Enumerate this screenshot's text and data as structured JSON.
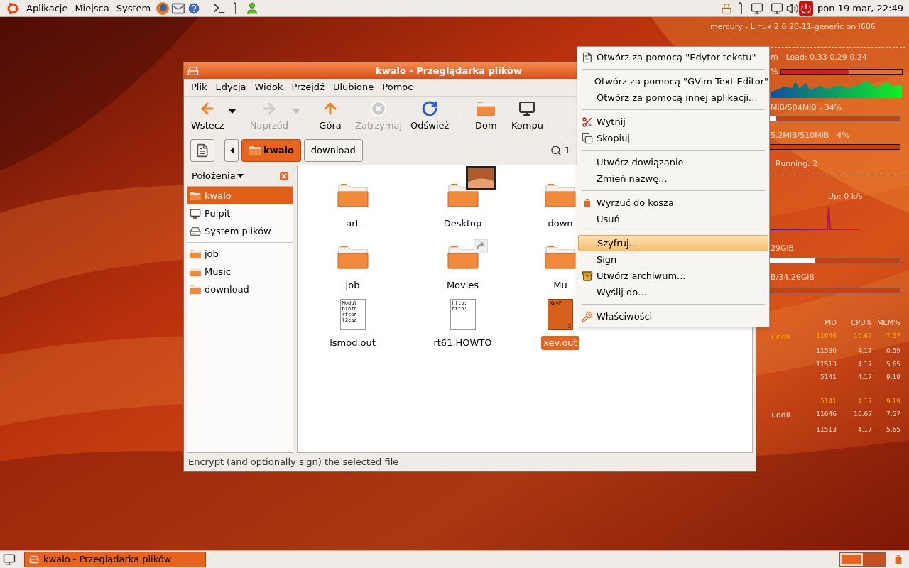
{
  "top_panel": {
    "menus": [
      "Aplikacje",
      "Miejsca",
      "System"
    ],
    "clock": "pon 19 mar, 22:49"
  },
  "conky": {
    "host": "mercury - Linux 2.6.20-11-generic on i686",
    "load": "m - Load: 0.33 0.29 0.24",
    "cpu_mark": "%",
    "cpu": {
      "level": 0.56
    },
    "ram": "MiB/504MiB - 34%",
    "ram_bar": {
      "level": 0.05
    },
    "swap": "5.2MiB/510MiB - 4%",
    "swap_bar": {
      "level": 0
    },
    "running": "Running: 2",
    "up": "Up: 0 k/s",
    "disk1": "29GiB",
    "disk1_bar": {
      "level": 0.35
    },
    "disk2": "B/34.26GiB",
    "disk2_bar": {
      "level": 0
    },
    "columns": [
      "PID",
      "CPU%",
      "MEM%"
    ],
    "top_cpu": [
      {
        "name": "uodli",
        "pid": "11646",
        "cpu": "16.67",
        "mem": "7.57",
        "highlight": true
      },
      {
        "pid": "11530",
        "cpu": "4.17",
        "mem": "0.59",
        "highlight": false
      },
      {
        "pid": "11513",
        "cpu": "4.17",
        "mem": "5.65",
        "highlight": false
      },
      {
        "pid": "5141",
        "cpu": "4.17",
        "mem": "9.19",
        "highlight": false
      }
    ],
    "top_mem": [
      {
        "pid": "5141",
        "cpu": "4.17",
        "mem": "9.19",
        "highlight": true
      },
      {
        "name": "uodli",
        "pid": "11646",
        "cpu": "16.67",
        "mem": "7.57",
        "highlight": false
      },
      {
        "pid": "11513",
        "cpu": "4.17",
        "mem": "5.65",
        "highlight": false
      }
    ]
  },
  "window": {
    "title": "kwalo - Przeglądarka plików",
    "menu": [
      "Plik",
      "Edycja",
      "Widok",
      "Przejdź",
      "Ulubione",
      "Pomoc"
    ],
    "toolbar": [
      {
        "kind": "back",
        "label": "Wstecz",
        "disabled": false,
        "dropdown": true
      },
      {
        "kind": "forward",
        "label": "Naprzód",
        "disabled": true,
        "dropdown": true
      },
      {
        "kind": "up",
        "label": "Góra",
        "disabled": false,
        "dropdown": false
      },
      {
        "kind": "stop",
        "label": "Zatrzymaj",
        "disabled": true,
        "dropdown": false
      },
      {
        "kind": "reload",
        "label": "Odśwież",
        "disabled": false,
        "dropdown": false
      },
      {
        "kind": "separator"
      },
      {
        "kind": "home",
        "label": "Dom",
        "disabled": false,
        "dropdown": false
      },
      {
        "kind": "computer",
        "label": "Kompu",
        "disabled": false,
        "dropdown": false
      }
    ],
    "path": [
      {
        "label": "kwalo",
        "selected": true
      },
      {
        "label": "download",
        "selected": false
      }
    ],
    "zoom": "1",
    "sidebar": {
      "title": "Położenia",
      "groups": [
        {
          "items": [
            {
              "kind": "home",
              "label": "kwalo",
              "selected": true
            },
            {
              "kind": "desktop",
              "label": "Pulpit",
              "selected": false
            },
            {
              "kind": "drive",
              "label": "System plików",
              "selected": false
            }
          ]
        },
        {
          "items": [
            {
              "kind": "folder",
              "label": "job",
              "selected": false
            },
            {
              "kind": "folder",
              "label": "Music",
              "selected": false
            },
            {
              "kind": "folder",
              "label": "download",
              "selected": false
            }
          ]
        }
      ]
    },
    "files": [
      {
        "kind": "folder",
        "name": "art",
        "selected": false
      },
      {
        "kind": "photos",
        "name": "Desktop",
        "selected": false
      },
      {
        "kind": "folder",
        "name": "down",
        "selected": false
      },
      {
        "kind": "folder",
        "name": "job",
        "selected": false
      },
      {
        "kind": "link",
        "name": "Movies",
        "selected": false
      },
      {
        "kind": "folder",
        "name": "Mu",
        "selected": false
      },
      {
        "kind": "text",
        "name": "lsmod.out",
        "preview": [
          "Modul",
          "binfn",
          "rfcon",
          "l2cac"
        ],
        "selected": false
      },
      {
        "kind": "text",
        "name": "rt61.HOWTO",
        "preview": [
          "http:",
          "http:"
        ],
        "selected": false
      },
      {
        "kind": "text",
        "name": "xev.out",
        "preview": [
          "KeyF",
          "3"
        ],
        "selected": true
      }
    ],
    "status": "Encrypt (and optionally sign) the selected file"
  },
  "context_menu": [
    {
      "kind": "item",
      "label": "Otwórz za pomocą \"Edytor tekstu\"",
      "selected": false
    },
    {
      "kind": "separator"
    },
    {
      "kind": "item",
      "label": "Otwórz za pomocą \"GVim Text Editor\"",
      "selected": false
    },
    {
      "kind": "item",
      "label": "Otwórz za pomocą innej aplikacji...",
      "selected": false
    },
    {
      "kind": "separator"
    },
    {
      "kind": "item",
      "label": "Wytnij",
      "selected": false
    },
    {
      "kind": "item",
      "label": "Skopiuj",
      "selected": false
    },
    {
      "kind": "separator"
    },
    {
      "kind": "item",
      "label": "Utwórz dowiązanie",
      "selected": false
    },
    {
      "kind": "item",
      "label": "Zmień nazwę...",
      "selected": false
    },
    {
      "kind": "separator"
    },
    {
      "kind": "item",
      "label": "Wyrzuć do kosza",
      "selected": false
    },
    {
      "kind": "item",
      "label": "Usuń",
      "selected": false
    },
    {
      "kind": "separator"
    },
    {
      "kind": "item",
      "label": "Szyfruj...",
      "selected": true
    },
    {
      "kind": "item",
      "label": "Sign",
      "selected": false
    },
    {
      "kind": "item",
      "label": "Utwórz archiwum...",
      "selected": false
    },
    {
      "kind": "item",
      "label": "Wyślij do...",
      "selected": false
    },
    {
      "kind": "separator"
    },
    {
      "kind": "item",
      "label": "Właściwości",
      "selected": false
    }
  ],
  "taskbar": {
    "tasks": [
      {
        "label": "kwalo - Przeglądarka plików",
        "selected": true
      }
    ],
    "workspaces": [
      {
        "selected": true
      },
      {
        "selected": false
      }
    ]
  }
}
